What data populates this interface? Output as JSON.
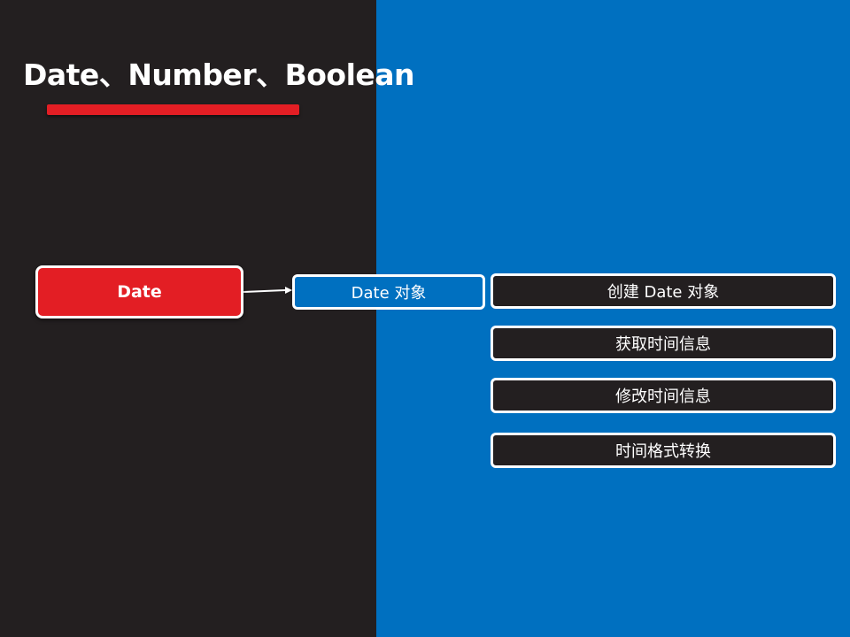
{
  "slide": {
    "title": "Date、Number、Boolean"
  },
  "diagram": {
    "root": {
      "label": "Date"
    },
    "child": {
      "label": "Date 对象"
    },
    "leaves": [
      {
        "label": "创建 Date 对象"
      },
      {
        "label": "获取时间信息"
      },
      {
        "label": "修改时间信息"
      },
      {
        "label": "时间格式转换"
      }
    ]
  },
  "colors": {
    "dark_background": "#231f20",
    "blue_panel": "#0070c0",
    "accent_red": "#e31e24",
    "border_white": "#ffffff"
  }
}
